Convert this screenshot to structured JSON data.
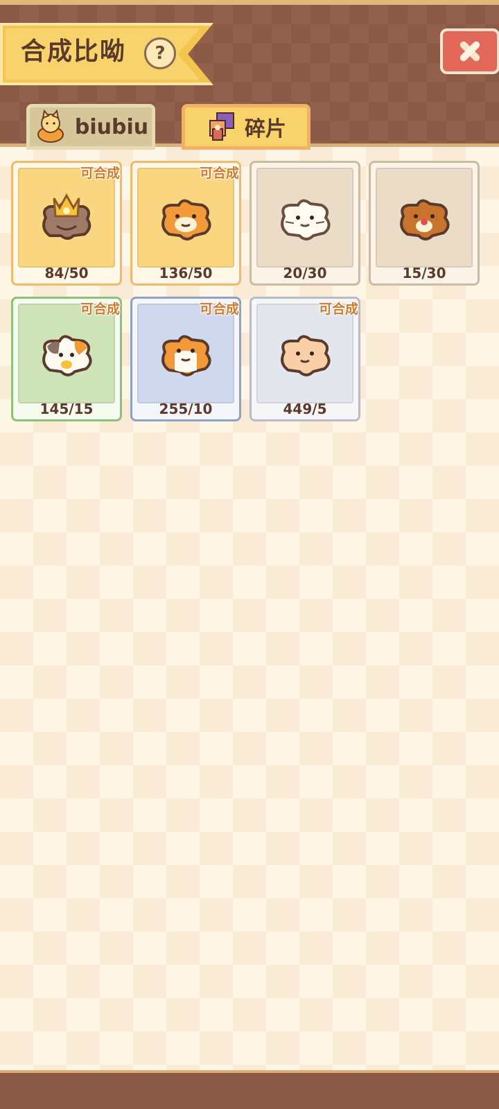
{
  "title": "合成比呦",
  "help_label": "?",
  "tabs": [
    {
      "label": "biubiu",
      "icon": "cat-icon",
      "active": false
    },
    {
      "label": "碎片",
      "icon": "puzzle-icon",
      "active": true
    }
  ],
  "cards": [
    {
      "count": "84/50",
      "tag": "可合成",
      "theme": "gold",
      "icon": "crowned-cat-puzzle-icon"
    },
    {
      "count": "136/50",
      "tag": "可合成",
      "theme": "gold",
      "icon": "orange-cat-puzzle-icon"
    },
    {
      "count": "20/30",
      "tag": "",
      "theme": "tan",
      "icon": "white-cat-puzzle-icon"
    },
    {
      "count": "15/30",
      "tag": "",
      "theme": "tan",
      "icon": "brown-cat-puzzle-icon"
    },
    {
      "count": "145/15",
      "tag": "可合成",
      "theme": "green",
      "icon": "calico-cat-puzzle-icon"
    },
    {
      "count": "255/10",
      "tag": "可合成",
      "theme": "blue",
      "icon": "orange-white-cat-puzzle-icon"
    },
    {
      "count": "449/5",
      "tag": "可合成",
      "theme": "gray",
      "icon": "cream-cat-puzzle-icon"
    }
  ],
  "colors": {
    "header": "#8a5a46",
    "accent": "#f8d26a",
    "tag": "#d07a2d"
  }
}
